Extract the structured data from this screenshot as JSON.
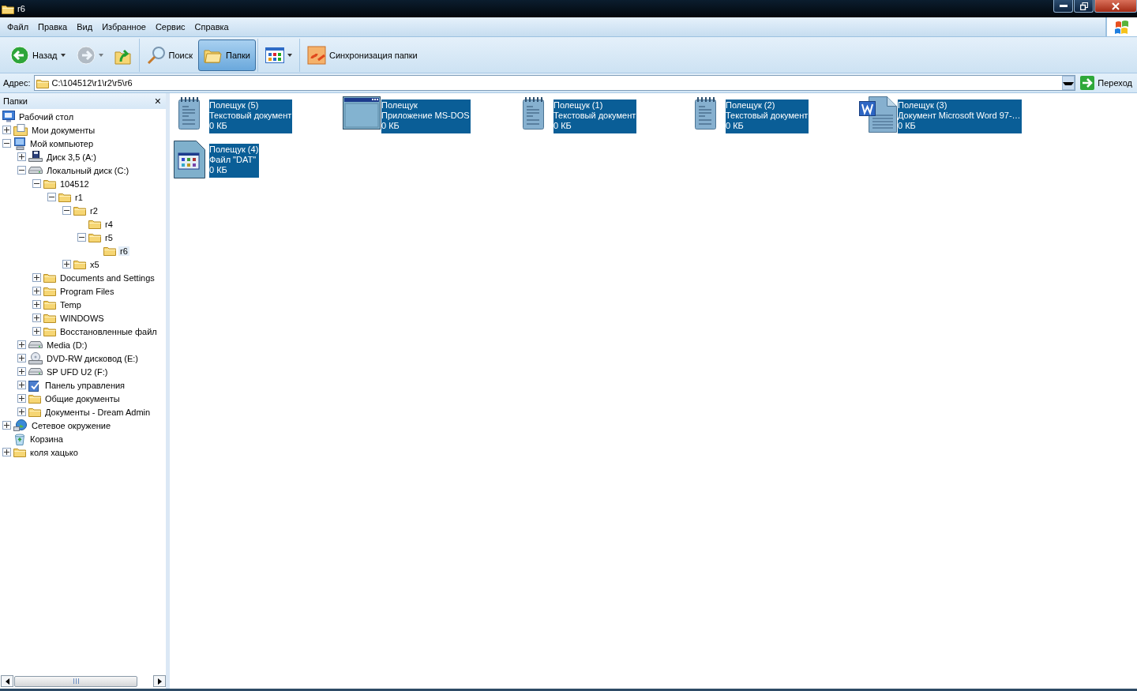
{
  "window": {
    "title": "r6"
  },
  "menu": [
    "Файл",
    "Правка",
    "Вид",
    "Избранное",
    "Сервис",
    "Справка"
  ],
  "toolbar": [
    {
      "kind": "back",
      "label": "Назад",
      "pressed": false,
      "disabled": false
    },
    {
      "kind": "forward",
      "pressed": false,
      "disabled": true
    },
    {
      "kind": "up",
      "pressed": false,
      "disabled": false
    },
    {
      "kind": "search",
      "label": "Поиск",
      "pressed": false,
      "disabled": false
    },
    {
      "kind": "folders",
      "label": "Папки",
      "pressed": true,
      "disabled": false
    },
    {
      "kind": "views",
      "pressed": false,
      "disabled": false
    },
    {
      "kind": "sync",
      "label": "Синхронизация папки",
      "pressed": false,
      "disabled": false
    }
  ],
  "address": {
    "label": "Адрес:",
    "value": "C:\\104512\\r1\\r2\\r5\\r6",
    "go": "Переход"
  },
  "sidebar": {
    "title": "Папки",
    "close": "×",
    "tree": [
      {
        "label": "Рабочий стол",
        "kind": "desktop",
        "selected": false,
        "children": [
          {
            "label": "Мои документы",
            "kind": "documents",
            "expanded": false,
            "selected": false
          },
          {
            "label": "Мой компьютер",
            "kind": "computer",
            "expanded": true,
            "selected": false,
            "children": [
              {
                "label": "Диск 3,5 (A:)",
                "kind": "floppy",
                "expanded": false,
                "selected": false
              },
              {
                "label": "Локальный диск (C:)",
                "kind": "drive",
                "expanded": true,
                "selected": false,
                "children": [
                  {
                    "label": "104512",
                    "kind": "folder",
                    "expanded": true,
                    "selected": false,
                    "children": [
                      {
                        "label": "r1",
                        "kind": "folder",
                        "expanded": true,
                        "selected": false,
                        "children": [
                          {
                            "label": "r2",
                            "kind": "folder",
                            "expanded": true,
                            "selected": false,
                            "children": [
                              {
                                "label": "r4",
                                "kind": "folder",
                                "selected": false
                              },
                              {
                                "label": "r5",
                                "kind": "folder",
                                "expanded": true,
                                "selected": false,
                                "children": [
                                  {
                                    "label": "r6",
                                    "kind": "folder",
                                    "selected": true
                                  }
                                ]
                              }
                            ]
                          },
                          {
                            "label": "x5",
                            "kind": "folder",
                            "expanded": false,
                            "selected": false
                          }
                        ]
                      }
                    ]
                  },
                  {
                    "label": "Documents and Settings",
                    "kind": "folder",
                    "expanded": false,
                    "selected": false
                  },
                  {
                    "label": "Program Files",
                    "kind": "folder",
                    "expanded": false,
                    "selected": false
                  },
                  {
                    "label": "Temp",
                    "kind": "folder",
                    "expanded": false,
                    "selected": false
                  },
                  {
                    "label": "WINDOWS",
                    "kind": "folder",
                    "expanded": false,
                    "selected": false
                  },
                  {
                    "label": "Восстановленные файл",
                    "kind": "folder",
                    "expanded": false,
                    "selected": false
                  }
                ]
              },
              {
                "label": "Media (D:)",
                "kind": "drive",
                "expanded": false,
                "selected": false
              },
              {
                "label": "DVD-RW дисковод (E:)",
                "kind": "dvd",
                "expanded": false,
                "selected": false
              },
              {
                "label": "SP UFD U2 (F:)",
                "kind": "drive",
                "expanded": false,
                "selected": false
              },
              {
                "label": "Панель управления",
                "kind": "control",
                "expanded": false,
                "selected": false
              },
              {
                "label": "Общие документы",
                "kind": "folder",
                "expanded": false,
                "selected": false
              },
              {
                "label": "Документы - Dream Admin",
                "kind": "folder",
                "expanded": false,
                "selected": false
              }
            ]
          },
          {
            "label": "Сетевое окружение",
            "kind": "network",
            "expanded": false,
            "selected": false
          },
          {
            "label": "Корзина",
            "kind": "recycle",
            "selected": false
          },
          {
            "label": "коля хацько",
            "kind": "folder",
            "expanded": false,
            "selected": false
          }
        ]
      }
    ]
  },
  "files": [
    {
      "name": "Полещук (5)",
      "type": "Текстовый документ",
      "size": "0 КБ",
      "kind": "text",
      "selected": true
    },
    {
      "name": "Полещук",
      "type": "Приложение MS-DOS",
      "size": "0 КБ",
      "kind": "dos",
      "selected": true
    },
    {
      "name": "Полещук (1)",
      "type": "Текстовый документ",
      "size": "0 КБ",
      "kind": "text",
      "selected": true
    },
    {
      "name": "Полещук (2)",
      "type": "Текстовый документ",
      "size": "0 КБ",
      "kind": "text",
      "selected": true
    },
    {
      "name": "Полещук (3)",
      "type": "Документ Microsoft Word 97-…",
      "size": "0 КБ",
      "kind": "word",
      "selected": true
    },
    {
      "name": "Полещук (4)",
      "type": "Файл \"DAT\"",
      "size": "0 КБ",
      "kind": "dat",
      "selected": true
    }
  ]
}
